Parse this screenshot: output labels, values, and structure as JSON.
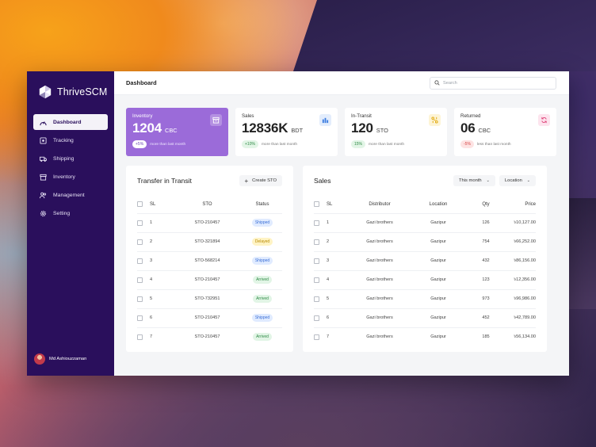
{
  "brand": {
    "name": "ThriveSCM"
  },
  "sidebar": {
    "items": [
      {
        "label": "Dashboard",
        "icon": "dashboard-icon",
        "active": true
      },
      {
        "label": "Tracking",
        "icon": "tracking-icon",
        "active": false
      },
      {
        "label": "Shipping",
        "icon": "truck-icon",
        "active": false
      },
      {
        "label": "Inventory",
        "icon": "inventory-icon",
        "active": false
      },
      {
        "label": "Management",
        "icon": "users-icon",
        "active": false
      },
      {
        "label": "Setting",
        "icon": "gear-icon",
        "active": false
      }
    ],
    "user": {
      "name": "Md Ashiouzzaman"
    }
  },
  "header": {
    "title": "Dashboard",
    "search_placeholder": "Search"
  },
  "stats": [
    {
      "label": "Inventory",
      "value": "1204",
      "unit": "CBC",
      "change": "+5%",
      "note": "more than last month",
      "trend": "white",
      "icon": "box-icon",
      "color": "#9b6bd9"
    },
    {
      "label": "Sales",
      "value": "12836K",
      "unit": "BDT",
      "change": "+10%",
      "note": "more than last month",
      "trend": "green",
      "icon": "chart-icon",
      "color": "#3a7be0"
    },
    {
      "label": "In-Transit",
      "value": "120",
      "unit": "STO",
      "change": "15%",
      "note": "more than last month",
      "trend": "green",
      "icon": "transit-icon",
      "color": "#e0a400"
    },
    {
      "label": "Returned",
      "value": "06",
      "unit": "CBC",
      "change": "-5%",
      "note": "less than last month",
      "trend": "red",
      "icon": "refresh-icon",
      "color": "#e0457a"
    }
  ],
  "transfer": {
    "title": "Transfer in Transit",
    "create_label": "Create STO",
    "columns": [
      "SL",
      "STO",
      "Status"
    ],
    "rows": [
      {
        "sl": "1",
        "sto": "STO-210457",
        "status": "Shipped"
      },
      {
        "sl": "2",
        "sto": "STO-321894",
        "status": "Delayed"
      },
      {
        "sl": "3",
        "sto": "STO-568214",
        "status": "Shipped"
      },
      {
        "sl": "4",
        "sto": "STO-210457",
        "status": "Arrived"
      },
      {
        "sl": "5",
        "sto": "STO-732951",
        "status": "Arrived"
      },
      {
        "sl": "6",
        "sto": "STO-210457",
        "status": "Shipped"
      },
      {
        "sl": "7",
        "sto": "STO-210457",
        "status": "Arrived"
      }
    ]
  },
  "sales": {
    "title": "Sales",
    "filter_month": "This month",
    "filter_location": "Location",
    "columns": [
      "SL",
      "Distributor",
      "Location",
      "Qty",
      "Price"
    ],
    "rows": [
      {
        "sl": "1",
        "distributor": "Gazi brothers",
        "location": "Gazipur",
        "qty": "126",
        "price": "৳10,127.00"
      },
      {
        "sl": "2",
        "distributor": "Gazi brothers",
        "location": "Gazipur",
        "qty": "754",
        "price": "৳66,252.00"
      },
      {
        "sl": "3",
        "distributor": "Gazi brothers",
        "location": "Gazipur",
        "qty": "432",
        "price": "৳86,156.00"
      },
      {
        "sl": "4",
        "distributor": "Gazi brothers",
        "location": "Gazipur",
        "qty": "123",
        "price": "৳12,356.00"
      },
      {
        "sl": "5",
        "distributor": "Gazi brothers",
        "location": "Gazipur",
        "qty": "973",
        "price": "৳96,986.00"
      },
      {
        "sl": "6",
        "distributor": "Gazi brothers",
        "location": "Gazipur",
        "qty": "452",
        "price": "৳42,789.00"
      },
      {
        "sl": "7",
        "distributor": "Gazi brothers",
        "location": "Gazipur",
        "qty": "185",
        "price": "৳56,134.00"
      }
    ]
  }
}
